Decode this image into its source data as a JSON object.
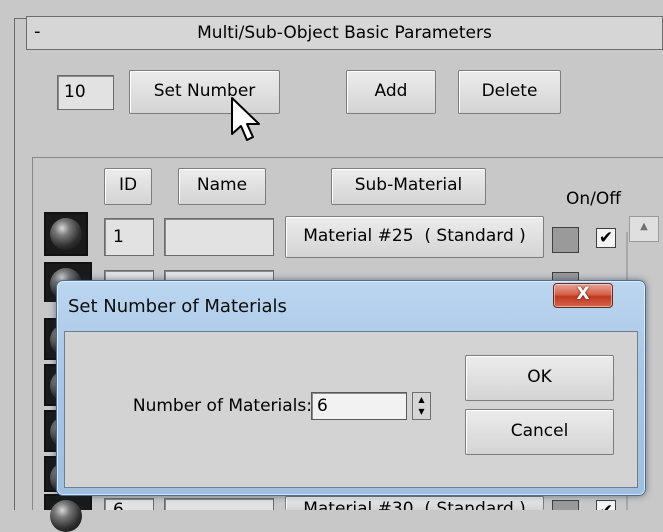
{
  "rollout": {
    "title": "Multi/Sub-Object Basic Parameters",
    "collapse_glyph": "-",
    "material_count": "10",
    "set_number_label": "Set Number",
    "add_label": "Add",
    "delete_label": "Delete"
  },
  "list": {
    "headers": {
      "id": "ID",
      "name": "Name",
      "sub_material": "Sub-Material",
      "on_off": "On/Off"
    },
    "rows": [
      {
        "id": "1",
        "name": "",
        "sub_material": "Material #25  ( Standard )",
        "enabled_check": "✔",
        "swatch_color": "#9a9a9a"
      },
      {
        "id": "",
        "name": "",
        "sub_material": "",
        "enabled_check": "",
        "swatch_color": "#9a9a9a"
      },
      {
        "id": "",
        "name": "",
        "sub_material": "",
        "enabled_check": "",
        "swatch_color": "#9a9a9a"
      },
      {
        "id": "",
        "name": "",
        "sub_material": "",
        "enabled_check": "",
        "swatch_color": "#9a9a9a"
      },
      {
        "id": "",
        "name": "",
        "sub_material": "",
        "enabled_check": "",
        "swatch_color": "#9a9a9a"
      },
      {
        "id": "",
        "name": "",
        "sub_material": "",
        "enabled_check": "",
        "swatch_color": "#9a9a9a"
      },
      {
        "id": "6",
        "name": "",
        "sub_material": "Material #30  ( Standard )",
        "enabled_check": "✔",
        "swatch_color": "#9a9a9a"
      }
    ]
  },
  "dialog": {
    "title": "Set Number of Materials",
    "close_glyph": "X",
    "field_label": "Number of Materials:",
    "value": "6",
    "ok_label": "OK",
    "cancel_label": "Cancel",
    "spin_up_glyph": "▲",
    "spin_down_glyph": "▼"
  },
  "colors": {
    "panel_background": "#c8c8c8",
    "dialog_frame": "#a9c7e6",
    "close_button": "#c0391f"
  },
  "icons": [
    "collapse-icon",
    "material-preview-sphere-icon",
    "scroll-up-icon",
    "spin-up-icon",
    "spin-down-icon",
    "close-icon",
    "mouse-cursor-icon"
  ]
}
